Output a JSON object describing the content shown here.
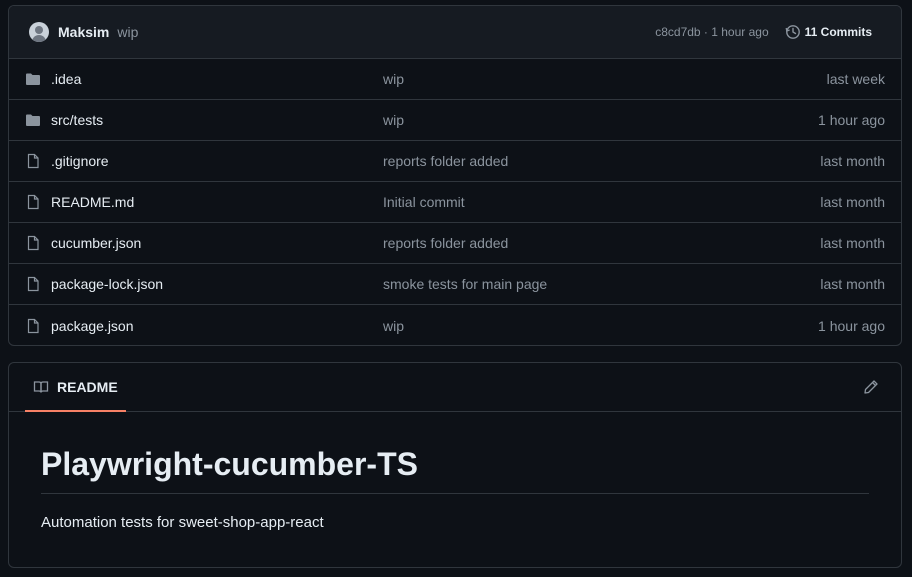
{
  "commit": {
    "author": "Maksim",
    "message": "wip",
    "sha_time": "c8cd7db · 1 hour ago",
    "commits_label": "11 Commits"
  },
  "files": [
    {
      "name": ".idea",
      "type": "folder",
      "message": "wip",
      "date": "last week"
    },
    {
      "name": "src/tests",
      "type": "folder",
      "message": "wip",
      "date": "1 hour ago"
    },
    {
      "name": ".gitignore",
      "type": "file",
      "message": "reports folder added",
      "date": "last month"
    },
    {
      "name": "README.md",
      "type": "file",
      "message": "Initial commit",
      "date": "last month"
    },
    {
      "name": "cucumber.json",
      "type": "file",
      "message": "reports folder added",
      "date": "last month"
    },
    {
      "name": "package-lock.json",
      "type": "file",
      "message": "smoke tests for main page",
      "date": "last month"
    },
    {
      "name": "package.json",
      "type": "file",
      "message": "wip",
      "date": "1 hour ago"
    }
  ],
  "readme": {
    "tab_label": "README",
    "title": "Playwright-cucumber-TS",
    "description": "Automation tests for sweet-shop-app-react"
  },
  "colors": {
    "background": "#0d1117",
    "border": "#30363d",
    "muted_text": "#8b949e",
    "tab_underline": "#f78166"
  },
  "icons": {
    "folder": "folder-icon",
    "file": "file-icon",
    "history": "history-icon",
    "book": "book-icon",
    "edit": "pencil-icon"
  }
}
